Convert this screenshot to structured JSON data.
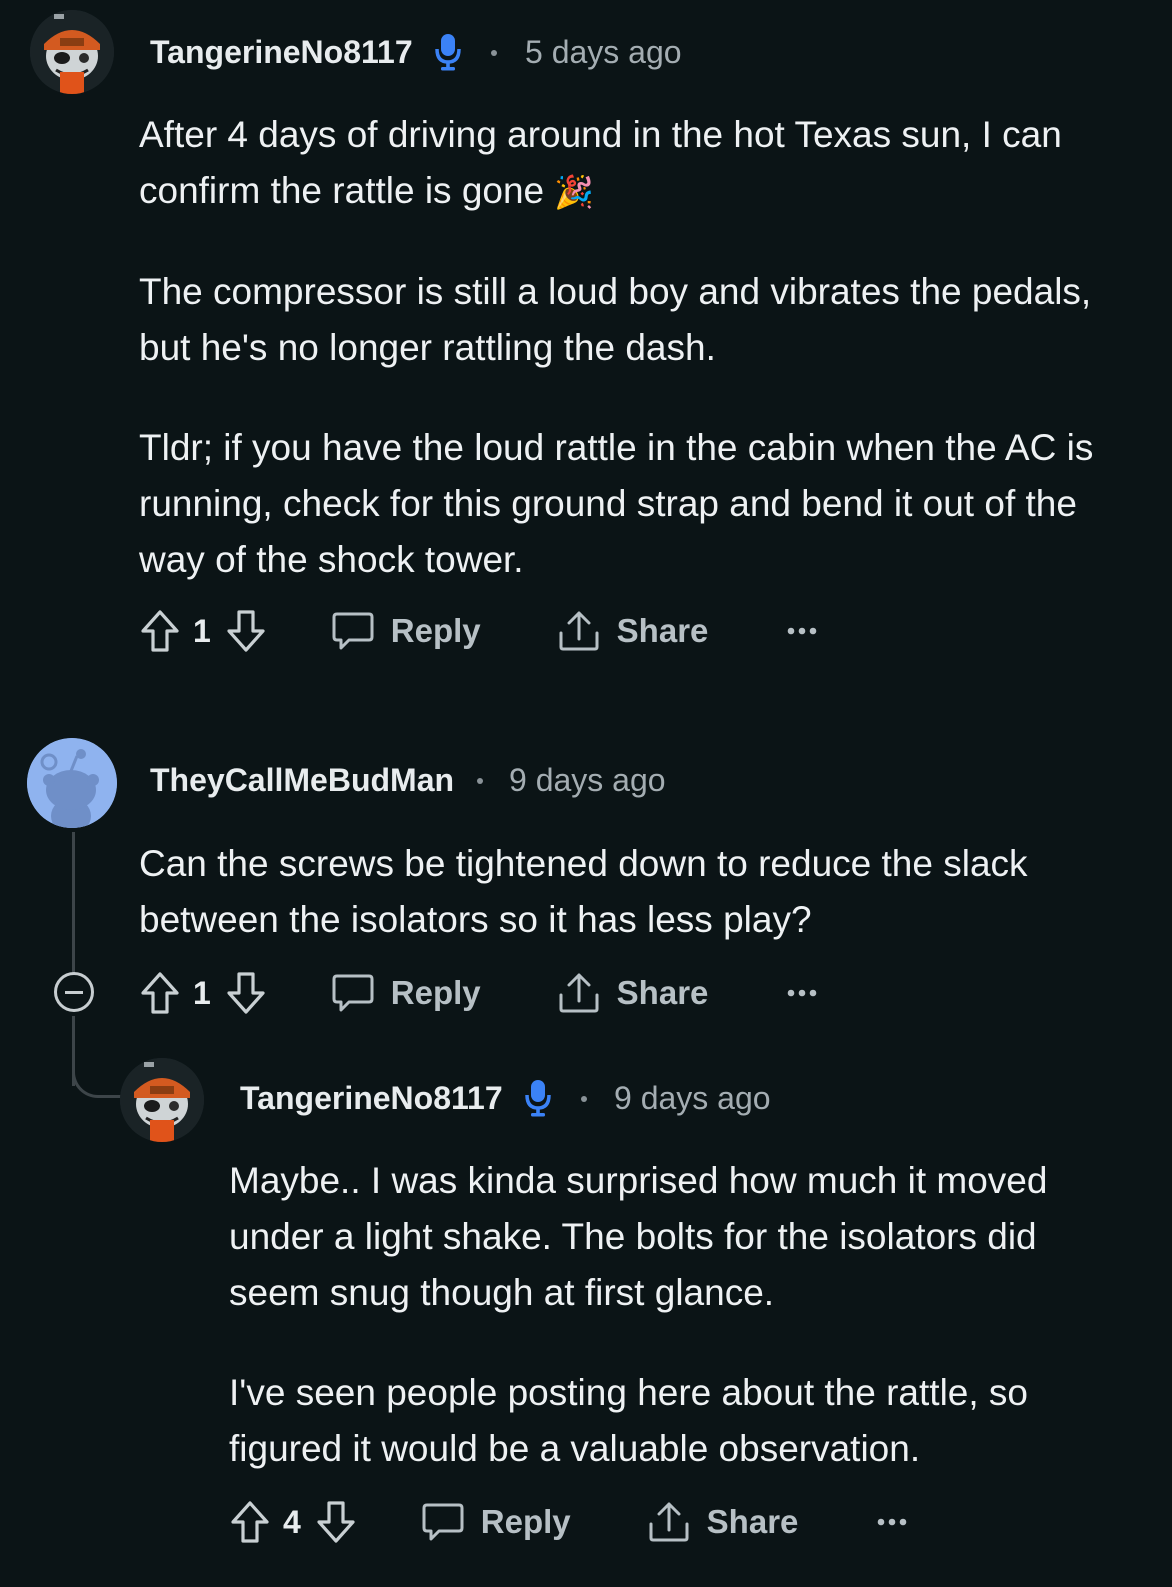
{
  "comments": [
    {
      "author": "TangerineNo8117",
      "time": "5 days ago",
      "paragraphs": [
        "After 4 days of driving around in the hot Texas sun, I can confirm the rattle is gone",
        "The compressor is still a loud boy and vibrates the pedals, but he's no longer rattling the dash.",
        "Tldr; if you have the loud rattle in the cabin when the AC is running, check for this ground strap and bend it out of the way of the shock tower."
      ],
      "emoji": "🎉",
      "votes": "1",
      "reply_label": "Reply",
      "share_label": "Share"
    },
    {
      "author": "TheyCallMeBudMan",
      "time": "9 days ago",
      "paragraphs": [
        "Can the screws be tightened down to reduce the slack between the isolators so it has less play?"
      ],
      "votes": "1",
      "reply_label": "Reply",
      "share_label": "Share"
    },
    {
      "author": "TangerineNo8117",
      "time": "9 days ago",
      "paragraphs": [
        "Maybe.. I was kinda surprised how much it moved under a light shake. The bolts for the isolators did seem snug though at first glance.",
        "I've seen people posting here about the rattle, so figured it would be a valuable observation."
      ],
      "votes": "4",
      "reply_label": "Reply",
      "share_label": "Share"
    }
  ],
  "colors": {
    "background": "#0b1416",
    "mic_blue": "#3b82f6",
    "snoo_bg": "#8fb3ef"
  },
  "icons": [
    "upvote-icon",
    "downvote-icon",
    "comment-icon",
    "share-icon",
    "more-icon",
    "microphone-icon",
    "collapse-icon"
  ]
}
